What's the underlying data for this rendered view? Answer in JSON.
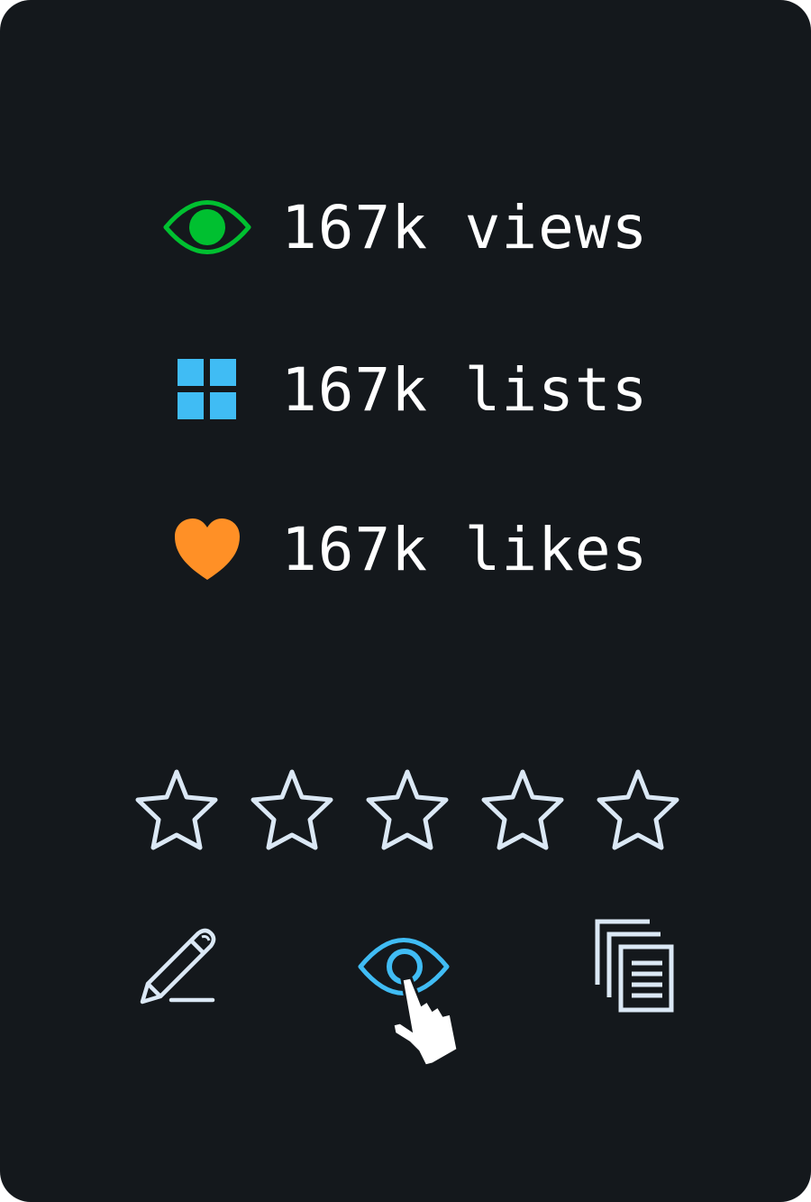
{
  "stats": [
    {
      "icon": "eye-icon",
      "color": "#00c030",
      "count": "167k",
      "label": "views",
      "text": "167k views"
    },
    {
      "icon": "grid-icon",
      "color": "#40bcf4",
      "count": "167k",
      "label": "lists",
      "text": "167k lists"
    },
    {
      "icon": "heart-icon",
      "color": "#ff9026",
      "count": "167k",
      "label": "likes",
      "text": "167k likes"
    }
  ],
  "rating": {
    "value": 0,
    "max": 5,
    "star_outline_color": "#dbe8f5"
  },
  "actions": [
    {
      "name": "review",
      "icon": "pencil-icon",
      "color": "#dbe8f5"
    },
    {
      "name": "watch",
      "icon": "eye-icon",
      "color": "#40bcf4",
      "hovered": true
    },
    {
      "name": "add-to-lists",
      "icon": "list-stack-icon",
      "color": "#dbe8f5"
    }
  ],
  "colors": {
    "background": "#14181c",
    "text": "#ffffff",
    "views": "#00c030",
    "lists": "#40bcf4",
    "likes": "#ff9026"
  }
}
